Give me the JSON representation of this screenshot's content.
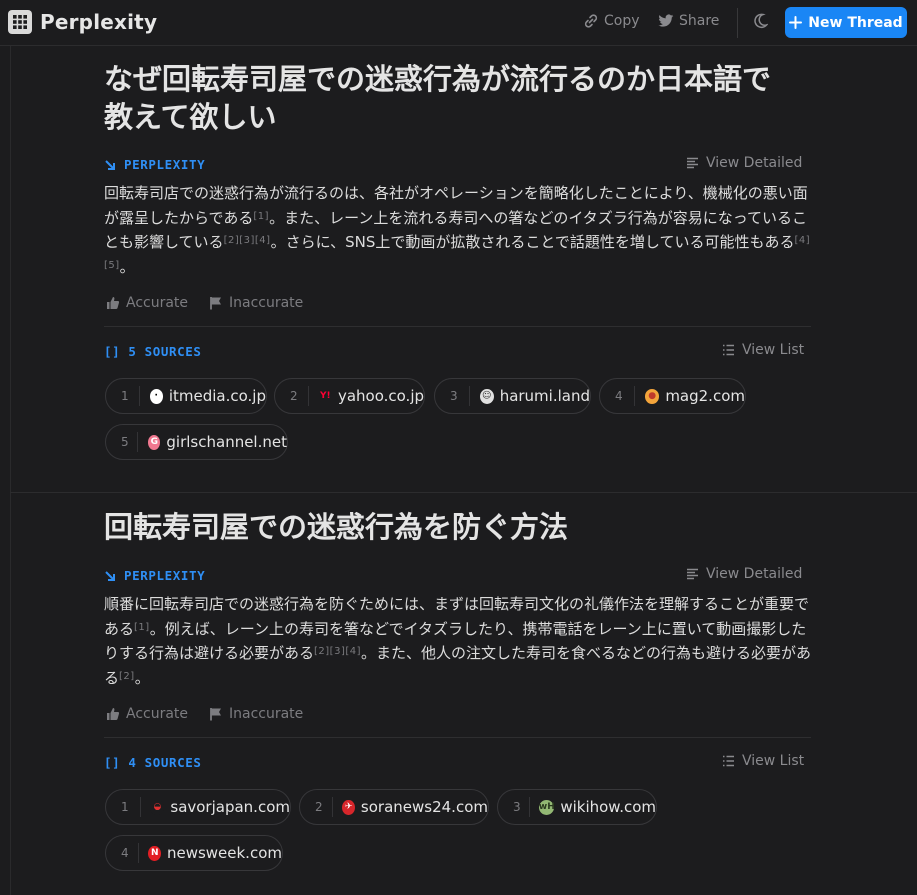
{
  "app": {
    "name": "Perplexity"
  },
  "header": {
    "copy_label": "Copy",
    "share_label": "Share",
    "new_thread_label": "New Thread"
  },
  "threads": [
    {
      "title_line1": "なぜ回転寿司屋での迷惑行為が流行るのか日本語で",
      "title_line2": "教えて欲しい",
      "source_label": "PERPLEXITY",
      "view_detailed": "View Detailed",
      "answer": [
        {
          "t": "回転寿司店での迷惑行為が流行るのは、各社がオペレーションを簡略化したことにより、機械化の悪い面が露呈したからである"
        },
        {
          "c": "[1]"
        },
        {
          "t": "。また、レーン上を流れる寿司への箸などのイタズラ行為が容易になっていることも影響している"
        },
        {
          "c": "[2][3][4]"
        },
        {
          "t": "。さらに、SNS上で動画が拡散されることで話題性を増している可能性もある"
        },
        {
          "c": "[4][5]"
        },
        {
          "t": "。"
        }
      ],
      "accurate": "Accurate",
      "inaccurate": "Inaccurate",
      "sources_label": "[] 5 SOURCES",
      "view_list": "View List",
      "sources": [
        {
          "num": "1",
          "domain": "itmedia.co.jp",
          "fav_bg": "#ffffff",
          "fav_fg": "#000000",
          "fav_char": "·"
        },
        {
          "num": "2",
          "domain": "yahoo.co.jp",
          "fav_bg": "#1c1c1e",
          "fav_fg": "#ff0033",
          "fav_char": "Y!"
        },
        {
          "num": "3",
          "domain": "harumi.land",
          "fav_bg": "#e0e0e0",
          "fav_fg": "#333333",
          "fav_char": "☺"
        },
        {
          "num": "4",
          "domain": "mag2.com",
          "fav_bg": "#f3a43b",
          "fav_fg": "#c0392b",
          "fav_char": "●"
        },
        {
          "num": "5",
          "domain": "girlschannel.net",
          "fav_bg": "#f07890",
          "fav_fg": "#ffffff",
          "fav_char": "G"
        }
      ]
    },
    {
      "title_line1": "回転寿司屋での迷惑行為を防ぐ方法",
      "title_line2": "",
      "source_label": "PERPLEXITY",
      "view_detailed": "View Detailed",
      "answer": [
        {
          "t": "順番に回転寿司店での迷惑行為を防ぐためには、まずは回転寿司文化の礼儀作法を理解することが重要である"
        },
        {
          "c": "[1]"
        },
        {
          "t": "。例えば、レーン上の寿司を箸などでイタズラしたり、携帯電話をレーン上に置いて動画撮影したりする行為は避ける必要がある"
        },
        {
          "c": "[2][3][4]"
        },
        {
          "t": "。また、他人の注文した寿司を食べるなどの行為も避ける必要がある"
        },
        {
          "c": "[2]"
        },
        {
          "t": "。"
        }
      ],
      "accurate": "Accurate",
      "inaccurate": "Inaccurate",
      "sources_label": "[] 4 SOURCES",
      "view_list": "View List",
      "sources": [
        {
          "num": "1",
          "domain": "savorjapan.com",
          "fav_bg": "#1c1c1e",
          "fav_fg": "#e03030",
          "fav_char": "◒"
        },
        {
          "num": "2",
          "domain": "soranews24.com",
          "fav_bg": "#d7262b",
          "fav_fg": "#ffffff",
          "fav_char": "✈"
        },
        {
          "num": "3",
          "domain": "wikihow.com",
          "fav_bg": "#93b874",
          "fav_fg": "#2b3a20",
          "fav_char": "wH"
        },
        {
          "num": "4",
          "domain": "newsweek.com",
          "fav_bg": "#e31e24",
          "fav_fg": "#ffffff",
          "fav_char": "N"
        }
      ]
    }
  ]
}
